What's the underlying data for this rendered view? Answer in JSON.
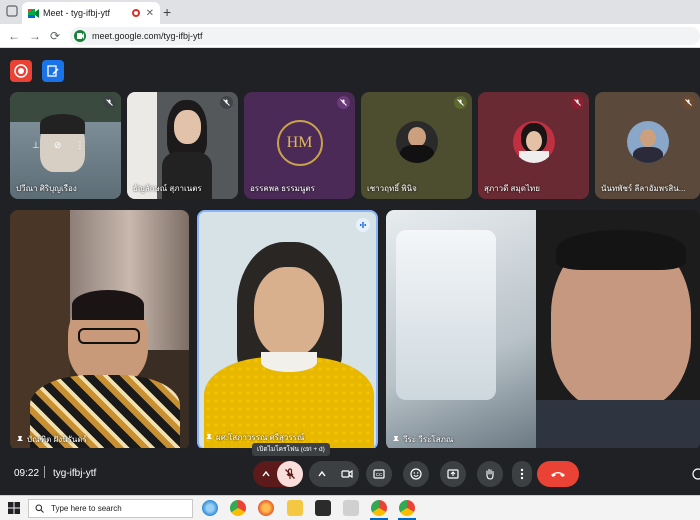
{
  "browser": {
    "tab_title": "Meet - tyg-ifbj-ytf",
    "tab_close": "✕",
    "new_tab": "+",
    "url": "meet.google.com/tyg-ifbj-ytf",
    "nav_back": "←",
    "nav_forward": "→",
    "nav_reload": "⟳"
  },
  "meet": {
    "top_tiles": [
      {
        "name": "ปวีณา ศิริบุญเรือง",
        "bg": "#6b7c86"
      },
      {
        "name": "ธัญลักษณ์ สุภาเนตร",
        "bg": "#5a5a5c"
      },
      {
        "name": "อรรคพล ธรรมนูตร",
        "bg": "#4a2a55"
      },
      {
        "name": "เชาวฤทธิ์ พินิจ",
        "bg": "#4a4a2e"
      },
      {
        "name": "สุภาวดี สมุดไทย",
        "bg": "#6b2a32"
      },
      {
        "name": "นันทพัชร์ ลีลาอัมพรสิน...",
        "bg": "#5a4a3a"
      }
    ],
    "logo_text": "HM",
    "main_tiles": [
      {
        "name": "บัณฑิต ฝังนิรันดร์"
      },
      {
        "name": "ผศ.โสภาวรรณ ศรีสุวรรณ์"
      },
      {
        "name": "วีระ วีระโสภณ"
      }
    ],
    "tooltip": "เปิดไมโครโฟน (ctrl + d)",
    "controls": {
      "time": "09:22",
      "separator": "|",
      "meeting_code": "tyg-ifbj-ytf"
    },
    "colors": {
      "accent_red": "#d93025",
      "bg": "#202124",
      "btn": "#3c4043"
    }
  },
  "taskbar": {
    "search_placeholder": "Type here to search"
  }
}
